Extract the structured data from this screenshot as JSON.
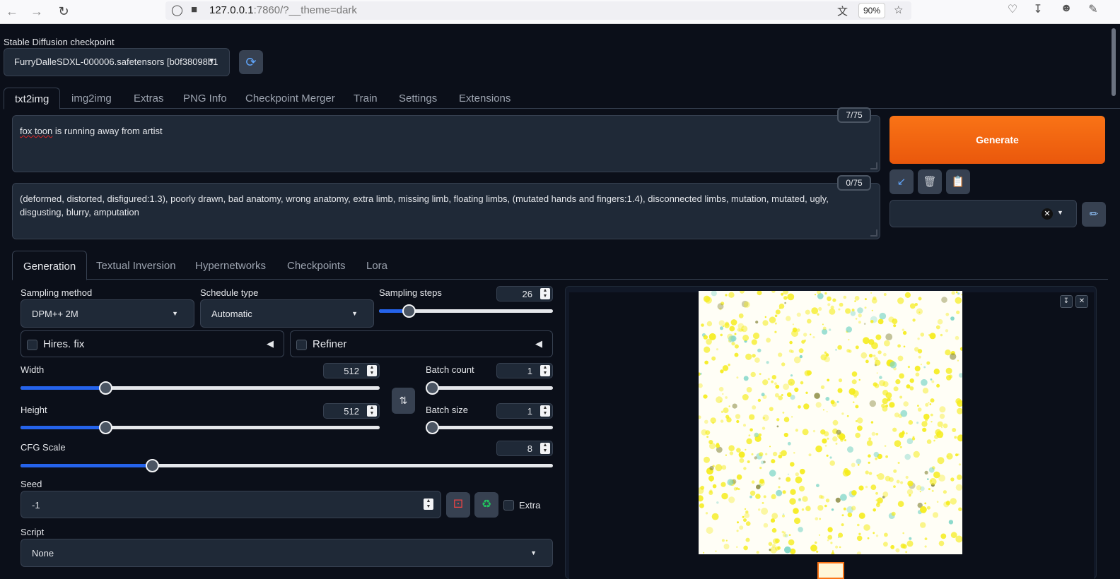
{
  "browser": {
    "url_host": "127.0.0.1",
    "url_rest": ":7860/?__theme=dark",
    "zoom": "90%"
  },
  "checkpoint": {
    "label": "Stable Diffusion checkpoint",
    "value": "FurryDalleSDXL-000006.safetensors [b0f38098b1"
  },
  "top_tabs": [
    "txt2img",
    "img2img",
    "Extras",
    "PNG Info",
    "Checkpoint Merger",
    "Train",
    "Settings",
    "Extensions"
  ],
  "prompt": {
    "text_a": "fox toon",
    "text_b": " is running away from artist",
    "tokens": "7/75"
  },
  "negative_prompt": {
    "text": "(deformed, distorted, disfigured:1.3), poorly drawn, bad anatomy, wrong anatomy, extra limb, missing limb, floating limbs, (mutated hands and fingers:1.4), disconnected limbs, mutation, mutated, ugly, disgusting, blurry, amputation",
    "tokens": "0/75"
  },
  "generate_label": "Generate",
  "gen_tabs": [
    "Generation",
    "Textual Inversion",
    "Hypernetworks",
    "Checkpoints",
    "Lora"
  ],
  "sampling_method": {
    "label": "Sampling method",
    "value": "DPM++ 2M"
  },
  "schedule_type": {
    "label": "Schedule type",
    "value": "Automatic"
  },
  "sampling_steps": {
    "label": "Sampling steps",
    "value": "26",
    "fraction": 0.17
  },
  "hires": {
    "label": "Hires. fix"
  },
  "refiner": {
    "label": "Refiner"
  },
  "width": {
    "label": "Width",
    "value": "512",
    "fraction": 0.236
  },
  "height": {
    "label": "Height",
    "value": "512",
    "fraction": 0.236
  },
  "batch_count": {
    "label": "Batch count",
    "value": "1",
    "fraction": 0
  },
  "batch_size": {
    "label": "Batch size",
    "value": "1",
    "fraction": 0
  },
  "cfg_scale": {
    "label": "CFG Scale",
    "value": "8",
    "fraction": 0.247
  },
  "seed": {
    "label": "Seed",
    "value": "-1",
    "extra_label": "Extra"
  },
  "script": {
    "label": "Script",
    "value": "None"
  },
  "colors": {
    "accent": "#f97316",
    "slider": "#2563eb",
    "bg": "#0b0f19"
  }
}
